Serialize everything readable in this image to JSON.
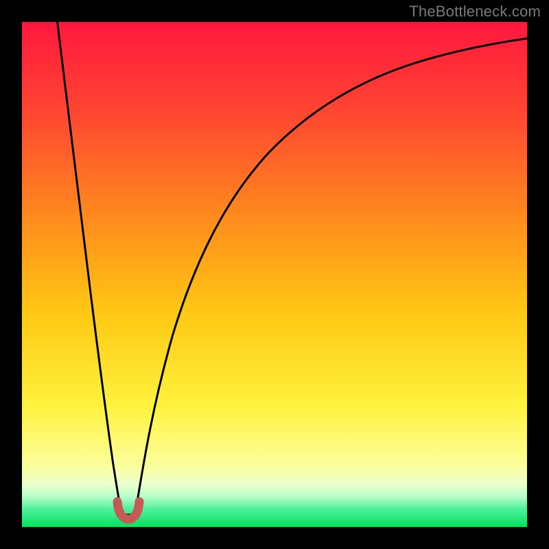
{
  "watermark": "TheBottleneck.com",
  "colors": {
    "frame": "#000000",
    "grad_top": "#ff173e",
    "grad_upper": "#ff5b2a",
    "grad_mid": "#ffb400",
    "grad_lower": "#fff23d",
    "grad_pale": "#faffad",
    "grad_green": "#02e35c",
    "curve": "#000000",
    "marker": "#c45b54"
  },
  "chart_data": {
    "type": "line",
    "title": "",
    "xlabel": "",
    "ylabel": "",
    "xlim": [
      0,
      100
    ],
    "ylim": [
      0,
      100
    ],
    "series": [
      {
        "name": "bottleneck-curve",
        "x": [
          7,
          8,
          10,
          12,
          14,
          16,
          17,
          18,
          19,
          20,
          21,
          22,
          24,
          28,
          34,
          42,
          52,
          64,
          78,
          100
        ],
        "values": [
          100,
          88,
          70,
          54,
          39,
          25,
          18,
          10,
          4,
          2,
          4,
          10,
          22,
          39,
          55,
          67,
          76,
          83,
          88,
          92
        ]
      }
    ],
    "minimum": {
      "x": 20,
      "y": 2
    },
    "annotations": []
  }
}
